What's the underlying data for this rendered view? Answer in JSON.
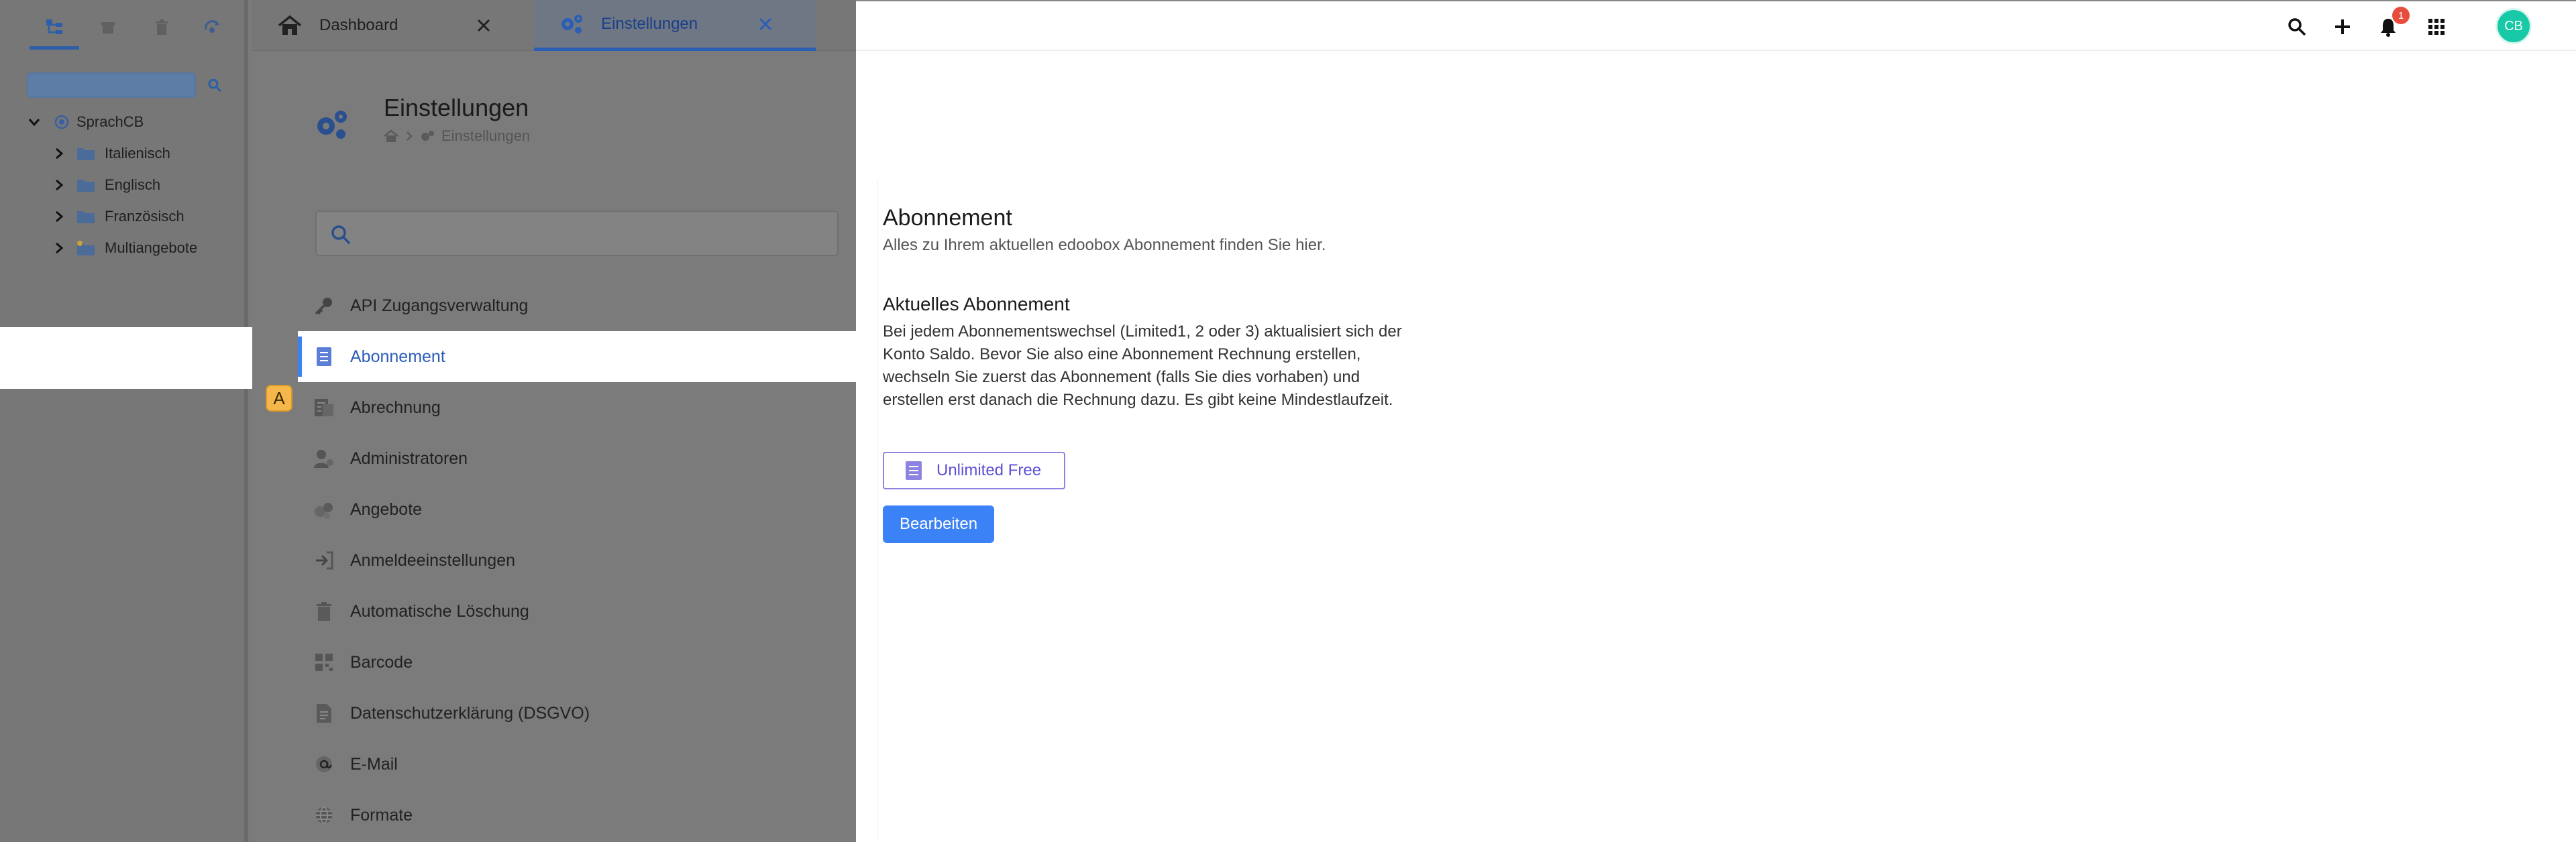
{
  "sidebar": {
    "tree": {
      "root": "SprachCB",
      "children": [
        {
          "label": "Italienisch"
        },
        {
          "label": "Englisch"
        },
        {
          "label": "Französisch"
        },
        {
          "label": "Multiangebote"
        }
      ]
    }
  },
  "tabs": [
    {
      "label": "Dashboard"
    },
    {
      "label": "Einstellungen"
    }
  ],
  "page": {
    "title": "Einstellungen",
    "breadcrumb": "Einstellungen"
  },
  "settings_menu": [
    {
      "label": "API Zugangsverwaltung",
      "icon": "key-icon"
    },
    {
      "label": "Abonnement",
      "icon": "document-icon",
      "active": true
    },
    {
      "label": "Abrechnung",
      "icon": "billing-icon"
    },
    {
      "label": "Administratoren",
      "icon": "admin-icon"
    },
    {
      "label": "Angebote",
      "icon": "offers-icon"
    },
    {
      "label": "Anmeldeeinstellungen",
      "icon": "login-icon"
    },
    {
      "label": "Automatische Löschung",
      "icon": "trash-icon"
    },
    {
      "label": "Barcode",
      "icon": "barcode-icon"
    },
    {
      "label": "Datenschutzerklärung (DSGVO)",
      "icon": "privacy-document-icon"
    },
    {
      "label": "E-Mail",
      "icon": "at-icon"
    },
    {
      "label": "Formate",
      "icon": "globe-icon"
    }
  ],
  "marker": "A",
  "topbar": {
    "notification_count": "1",
    "avatar_initials": "CB"
  },
  "content": {
    "title": "Abonnement",
    "subtitle": "Alles zu Ihrem aktuellen edoobox Abonnement finden Sie hier.",
    "section_title": "Aktuelles Abonnement",
    "paragraph": "Bei jedem Abonnementswechsel (Limited1, 2 oder 3) aktualisiert sich der Konto Saldo. Bevor Sie also eine Abonnement Rechnung erstellen, wechseln Sie zuerst das Abonnement (falls Sie dies vorhaben) und erstellen erst danach die Rechnung dazu. Es gibt keine Mindestlaufzeit.",
    "plan_label": "Unlimited Free",
    "edit_label": "Bearbeiten"
  },
  "colors": {
    "accent": "#3b82f6",
    "plan": "#5a4fd6",
    "avatar": "#17c9a6",
    "notification": "#e74c3c"
  }
}
